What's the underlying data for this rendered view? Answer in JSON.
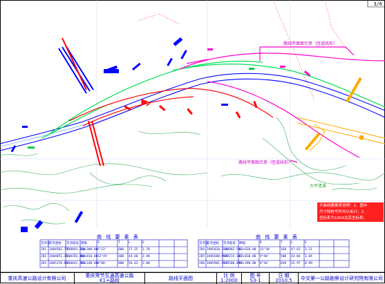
{
  "page_number": "3/6",
  "labels": {
    "upper_ramp": "路线平面图示意（匝道线形）",
    "lower_ramp": "路线平面图示意（匝道线形）",
    "place_name": "大坪清溪"
  },
  "note_lines": [
    "平曲线要素表说明：1、图中",
    "尺寸除桩号外均以米计；2、",
    "坐标系为1954北京坐标系；"
  ],
  "left_table": {
    "title": "曲 线 要 素 表",
    "headers": [
      "交点号",
      "交点坐标",
      "交点桩号",
      "转角",
      "R",
      "T",
      "L",
      "E"
    ],
    "rows": [
      [
        "JD1",
        "3404502.735",
        "518093.214",
        "K0+380.00",
        "5°12'",
        "600",
        "27.25",
        "1.70"
      ],
      [
        "JD2",
        "3404851.101",
        "518356.402",
        "K0+816.00",
        "12°45'",
        "400",
        "44.68",
        "2.98"
      ],
      [
        "JD3",
        "3405170.883",
        "518641.730",
        "K1+248.00",
        "8°06'",
        "800",
        "56.63",
        "2.00"
      ]
    ]
  },
  "right_table": {
    "title": "曲 线 要 素 表",
    "headers": [
      "交点号",
      "交点坐标",
      "交点桩号",
      "转角",
      "R",
      "T",
      "L",
      "E"
    ],
    "rows": [
      [
        "JD4",
        "3405420.118",
        "518902.541",
        "K1+620.00",
        "15°30'",
        "350",
        "47.62",
        "3.21"
      ],
      [
        "JD5",
        "3405688.940",
        "519215.307",
        "K2+030.00",
        "9°48'",
        "500",
        "42.86",
        "1.84"
      ],
      [
        "JD6",
        "3405901.265",
        "519508.876",
        "K2+390.00",
        "6°20'",
        "650",
        "35.97",
        "0.99"
      ]
    ]
  },
  "title_block": {
    "designer": "重庆高速公路设计有限公司",
    "project": "重庆常节互通高速公路",
    "project_sub": "K1+路段",
    "drawing": "路线平面图",
    "scale_label": "比 例",
    "scale_value": "1:2000",
    "sheet_label": "图 号",
    "sheet_value": "S3-1",
    "date_label": "日 期",
    "date_value": "2010.5",
    "institute": "中交第一公路勘察设计研究院有限公司"
  },
  "colors": {
    "mainline": "#0000ff",
    "ramp_green": "#00dd55",
    "ramp_magenta": "#ff00cc",
    "red_road": "#ff1010",
    "yellow_road": "#ffaa00",
    "terrain": "#33aa55",
    "grid": "#7777ff"
  }
}
